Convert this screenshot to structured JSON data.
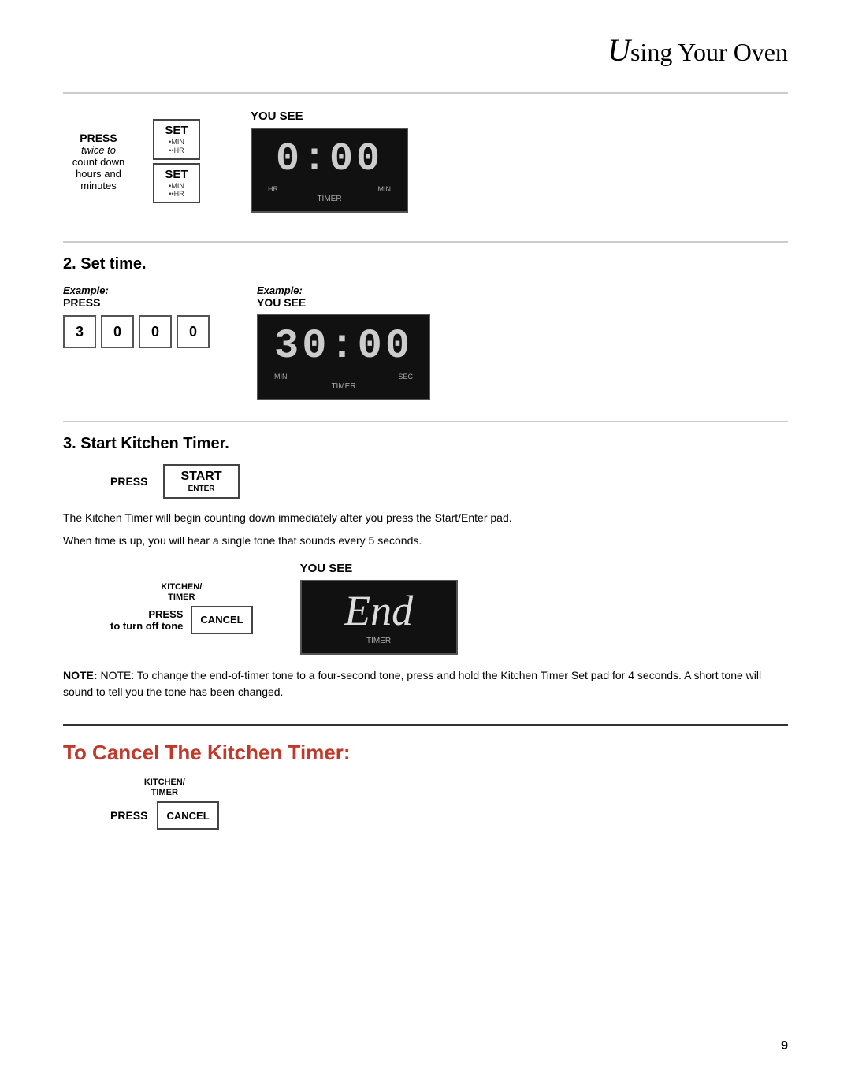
{
  "header": {
    "title": "Using Your Oven",
    "cursive": "U",
    "rest": "sing Your Oven"
  },
  "step1": {
    "press_label_line1": "PRESS",
    "press_label_line2": "twice to",
    "press_label_line3": "count down",
    "press_label_line4": "hours and",
    "press_label_line5": "minutes",
    "btn1_main": "SET",
    "btn1_sub1": "•MIN",
    "btn1_sub2": "••HR",
    "btn2_main": "SET",
    "btn2_sub1": "•MIN",
    "btn2_sub2": "••HR",
    "you_see": "YOU SEE",
    "display1_text": "0:00",
    "display1_hr": "HR",
    "display1_min": "MIN",
    "display1_timer": "TIMER"
  },
  "step2": {
    "title": "2. Set time.",
    "example_press": "Example:\nPRESS",
    "example_you_see": "Example:\nYOU SEE",
    "keys": [
      "3",
      "0",
      "0",
      "0"
    ],
    "display_text": "30:00",
    "display_min": "MIN",
    "display_sec": "SEC",
    "display_timer": "TIMER"
  },
  "step3": {
    "title": "3. Start Kitchen Timer.",
    "press_label": "PRESS",
    "start_btn_main": "START",
    "start_btn_sub": "ENTER",
    "body1": "The Kitchen Timer will begin counting down immediately after you press the Start/Enter pad.",
    "body2": "When time is up, you will hear a single tone that sounds every 5 seconds.",
    "press_turn_off": "PRESS\nto turn off tone",
    "kitchen_timer_label": "KITCHEN/\nTIMER",
    "cancel_btn": "CANCEL",
    "you_see": "YOU SEE",
    "display_end_text": "End",
    "display_end_timer": "TIMER",
    "note_text": "NOTE: To change the end-of-timer tone to a four-second tone, press and hold the Kitchen Timer Set pad for 4 seconds. A short tone will sound to tell you the tone has been changed."
  },
  "cancel_section": {
    "title": "To Cancel The Kitchen Timer:",
    "press_label": "PRESS",
    "kitchen_timer_label": "KITCHEN/\nTIMER",
    "cancel_btn": "CANCEL"
  },
  "page_number": "9"
}
